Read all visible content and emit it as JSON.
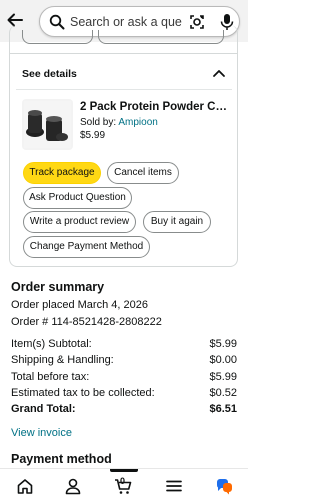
{
  "search": {
    "placeholder": "Search or ask a que..."
  },
  "details": {
    "toggle_label": "See details"
  },
  "product": {
    "title": "2 Pack Protein Powder Co...",
    "seller_prefix": "Sold by: ",
    "seller": "Ampioon",
    "price": "$5.99"
  },
  "actions": {
    "track": "Track package",
    "cancel": "Cancel items",
    "ask": "Ask Product Question",
    "review": "Write a product review",
    "buy_again": "Buy it again",
    "change_payment": "Change Payment Method"
  },
  "summary": {
    "title": "Order summary",
    "placed": "Order placed March 4, 2026",
    "order_number": "Order # 114-8521428-2808222",
    "rows": [
      {
        "label": "Item(s) Subtotal:",
        "value": "$5.99"
      },
      {
        "label": "Shipping & Handling:",
        "value": "$0.00"
      },
      {
        "label": "Total before tax:",
        "value": "$5.99"
      },
      {
        "label": "Estimated tax to be collected:",
        "value": "$0.52"
      },
      {
        "label": "Grand Total:",
        "value": "$6.51"
      }
    ],
    "view_invoice": "View invoice"
  },
  "payment": {
    "title": "Payment method"
  },
  "nav": {
    "cart_count": "0"
  },
  "colors": {
    "accent_yellow": "#ffd814",
    "link_teal": "#007185",
    "topbar_bg": "#f2f2f2",
    "border": "#d5d9d9",
    "assistant_orange": "#ff6a00",
    "assistant_blue": "#1f6feb"
  },
  "icons": [
    "back-arrow-icon",
    "search-icon",
    "camera-lens-icon",
    "microphone-icon",
    "chevron-up-icon",
    "home-icon",
    "profile-icon",
    "cart-icon",
    "menu-icon",
    "assistant-icon"
  ]
}
